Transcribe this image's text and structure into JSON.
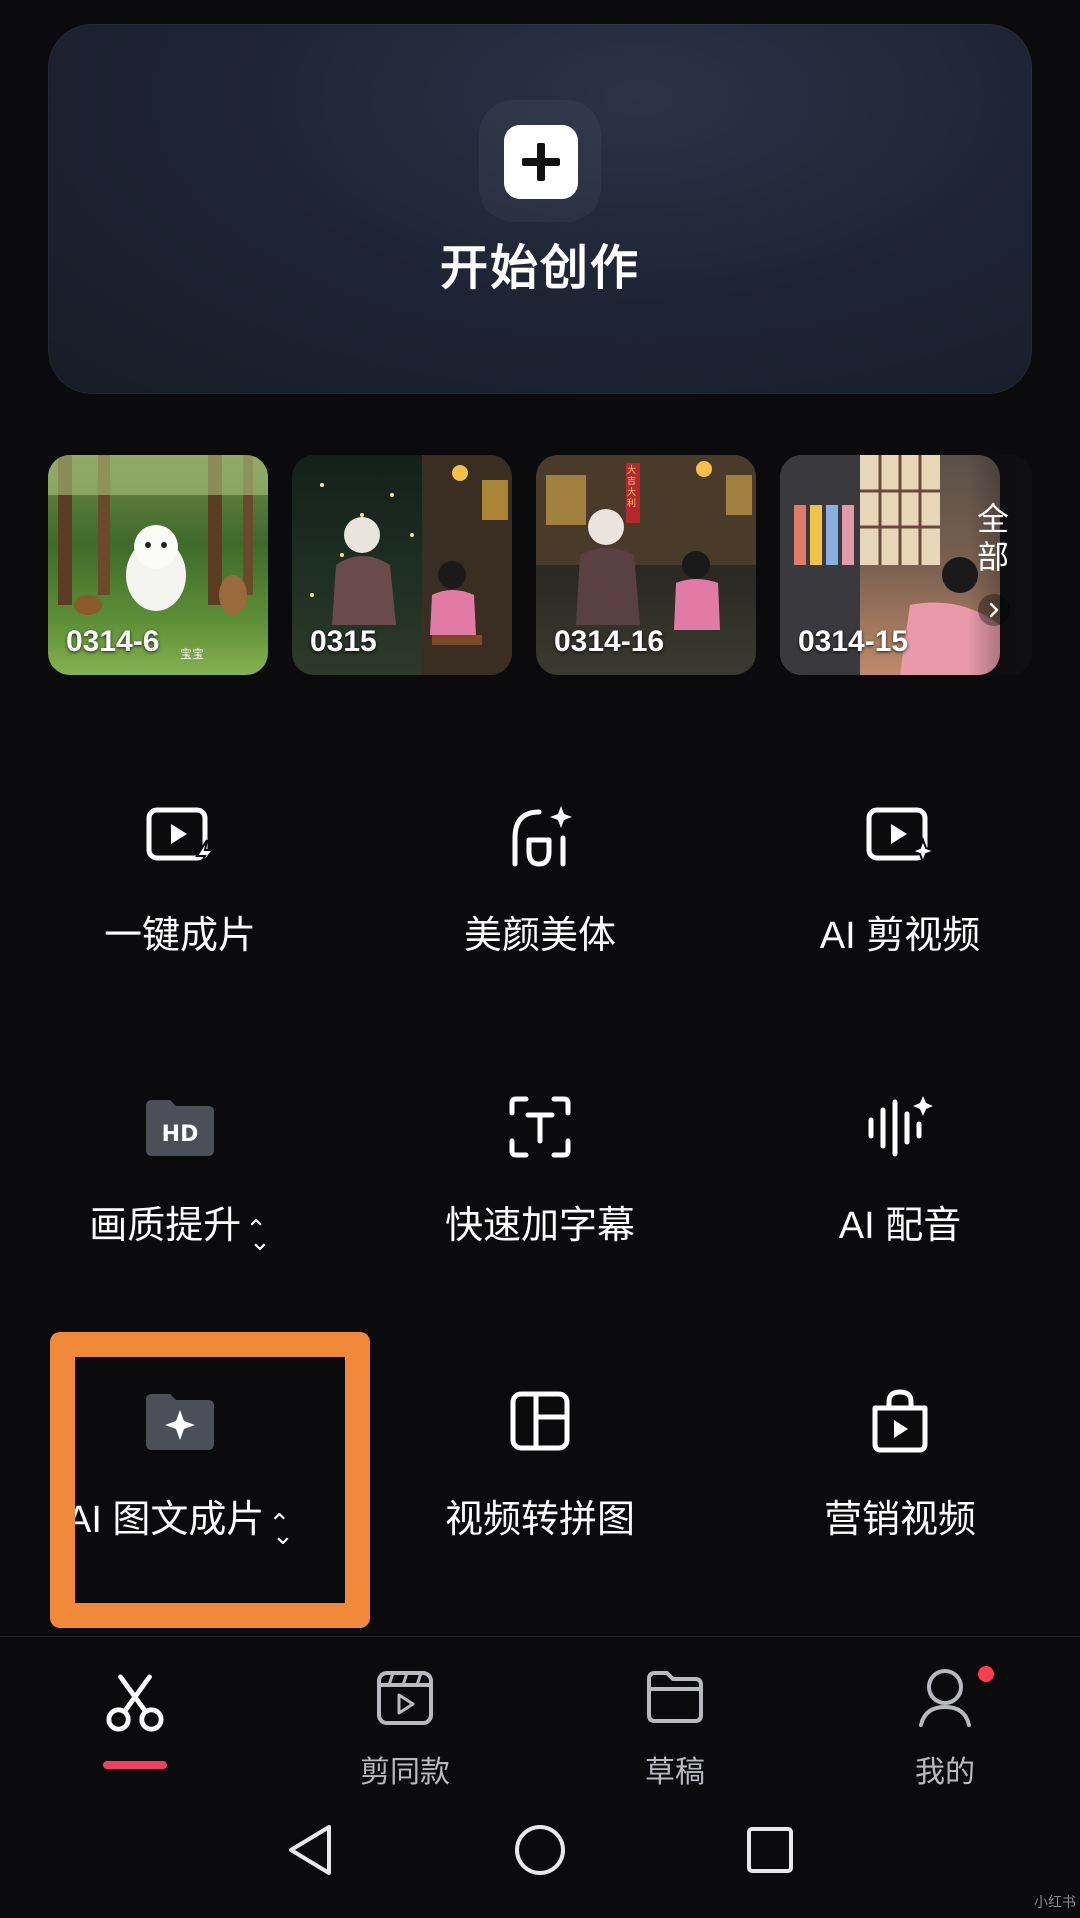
{
  "start_card": {
    "label": "开始创作",
    "icon": "plus-icon"
  },
  "drafts": [
    {
      "caption": "0314-6",
      "overlay_text": "宝宝"
    },
    {
      "caption": "0315"
    },
    {
      "caption": "0314-16",
      "overlay_text": "大吉大利"
    },
    {
      "caption": "0314-15"
    }
  ],
  "drafts_more": {
    "label": "全部",
    "icon": "chevron-right-icon"
  },
  "tools": [
    {
      "label": "一键成片",
      "icon": "video-lightning-icon"
    },
    {
      "label": "美颜美体",
      "icon": "face-sparkle-icon"
    },
    {
      "label": "AI 剪视频",
      "icon": "video-sparkle-icon"
    },
    {
      "label": "画质提升",
      "icon": "hd-icon",
      "has_toggle": true
    },
    {
      "label": "快速加字幕",
      "icon": "text-frame-icon"
    },
    {
      "label": "AI 配音",
      "icon": "audio-wave-icon"
    },
    {
      "label": "AI 图文成片",
      "icon": "folder-sparkle-icon",
      "has_toggle": true
    },
    {
      "label": "视频转拼图",
      "icon": "layout-grid-icon"
    },
    {
      "label": "营销视频",
      "icon": "shopping-bag-play-icon"
    }
  ],
  "highlight_color": "#f08a3a",
  "bottom_nav": [
    {
      "label": "",
      "icon": "scissors-icon",
      "active": true
    },
    {
      "label": "剪同款",
      "icon": "clapperboard-icon"
    },
    {
      "label": "草稿",
      "icon": "folder-icon"
    },
    {
      "label": "我的",
      "icon": "person-icon",
      "badge": true
    }
  ],
  "system_nav": [
    "back-icon",
    "home-icon",
    "recents-icon"
  ],
  "watermark": "小红书",
  "colors": {
    "accent": "#f0405f",
    "badge": "#ff3b4e",
    "background": "#0b0b0e"
  }
}
